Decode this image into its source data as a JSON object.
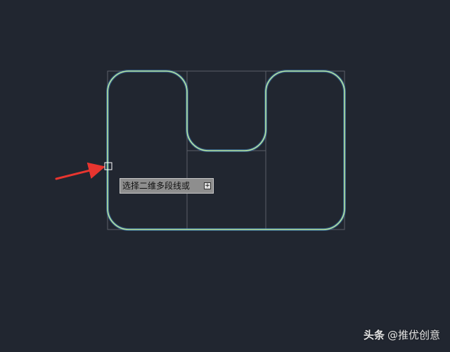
{
  "prompt": {
    "text": "选择二维多段线或",
    "toggle": "+"
  },
  "watermark": {
    "brand": "头条",
    "handle": "@推优创意"
  },
  "colors": {
    "background": "#212630",
    "outline": "#b8e6a0",
    "outline_glow": "#3f86c9",
    "guide": "#5a5f68",
    "arrow": "#e8352f",
    "pickbox": "#ffffff"
  },
  "icons": {
    "prompt_toggle": "plus-box-icon",
    "arrow": "red-arrow-icon",
    "pickbox": "pickbox-cursor-icon"
  }
}
